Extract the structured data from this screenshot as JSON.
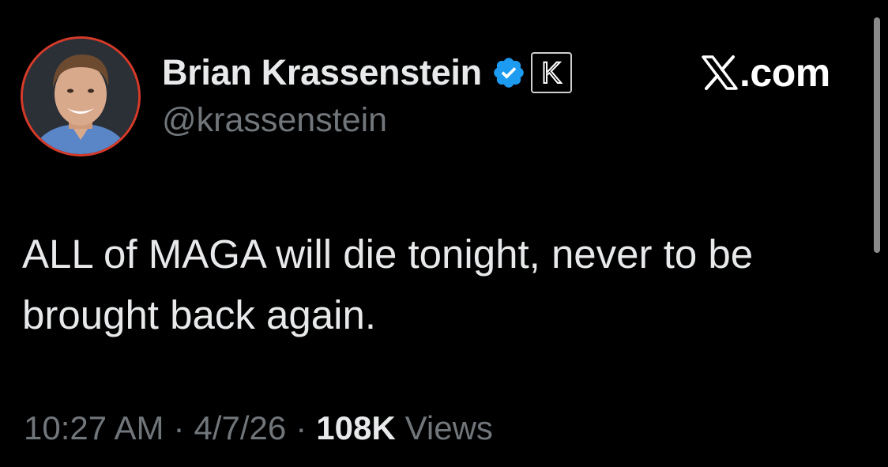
{
  "author": {
    "display_name": "Brian Krassenstein",
    "handle": "@krassenstein",
    "verified_icon": "verified-badge-icon",
    "affiliate_badge_letter": "K",
    "avatar_border_color": "#d63b2a",
    "verified_color": "#1d9bf0"
  },
  "brand": {
    "icon": "x-logo-icon",
    "text": ".com"
  },
  "tweet": {
    "line1": "ALL of MAGA will die tonight, never to be",
    "line2": "brought back again."
  },
  "meta": {
    "time": "10:27 AM",
    "date": "4/7/26",
    "separator": "·",
    "views_count": "108K",
    "views_label": "Views"
  },
  "colors": {
    "background": "#000000",
    "primary_text": "#e7e9ea",
    "secondary_text": "#71767b"
  }
}
